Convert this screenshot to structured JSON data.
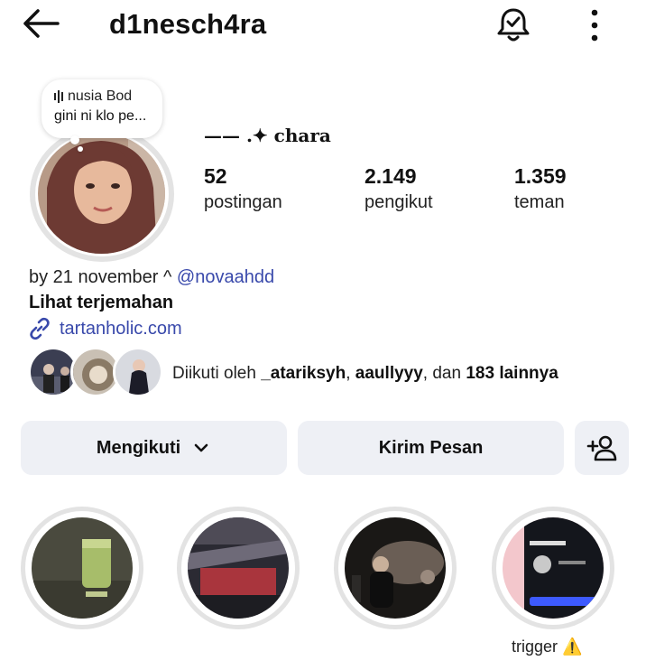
{
  "header": {
    "username": "d1nesch4ra",
    "back_icon": "arrow-left-icon",
    "notification_icon": "bell-check-icon",
    "more_icon": "vertical-dots-icon"
  },
  "note": {
    "music_title": "nusia Bod",
    "text": "gini ni klo pe..."
  },
  "profile": {
    "display_name": "—— .✦ chara",
    "stats": [
      {
        "count": "52",
        "label": "postingan"
      },
      {
        "count": "2.149",
        "label": "pengikut"
      },
      {
        "count": "1.359",
        "label": "teman"
      }
    ],
    "bio_prefix": "by 21 november ^ ",
    "bio_mention": "@novaahdd",
    "translate_label": "Lihat terjemahan",
    "link": "tartanholic.com",
    "followed_by": {
      "prefix": "Diikuti oleh ",
      "user1": "_atariksyh",
      "sep": ", ",
      "user2": "aaullyyy",
      "mid": ", dan ",
      "count": "183 lainnya"
    }
  },
  "buttons": {
    "follow_label": "Mengikuti",
    "message_label": "Kirim Pesan"
  },
  "highlights": [
    {
      "label": ""
    },
    {
      "label": ""
    },
    {
      "label": ""
    },
    {
      "label": "trigger ⚠️"
    }
  ],
  "colors": {
    "link": "#3949ab",
    "button_bg": "#eef0f5",
    "ring": "#e3e3e3"
  }
}
